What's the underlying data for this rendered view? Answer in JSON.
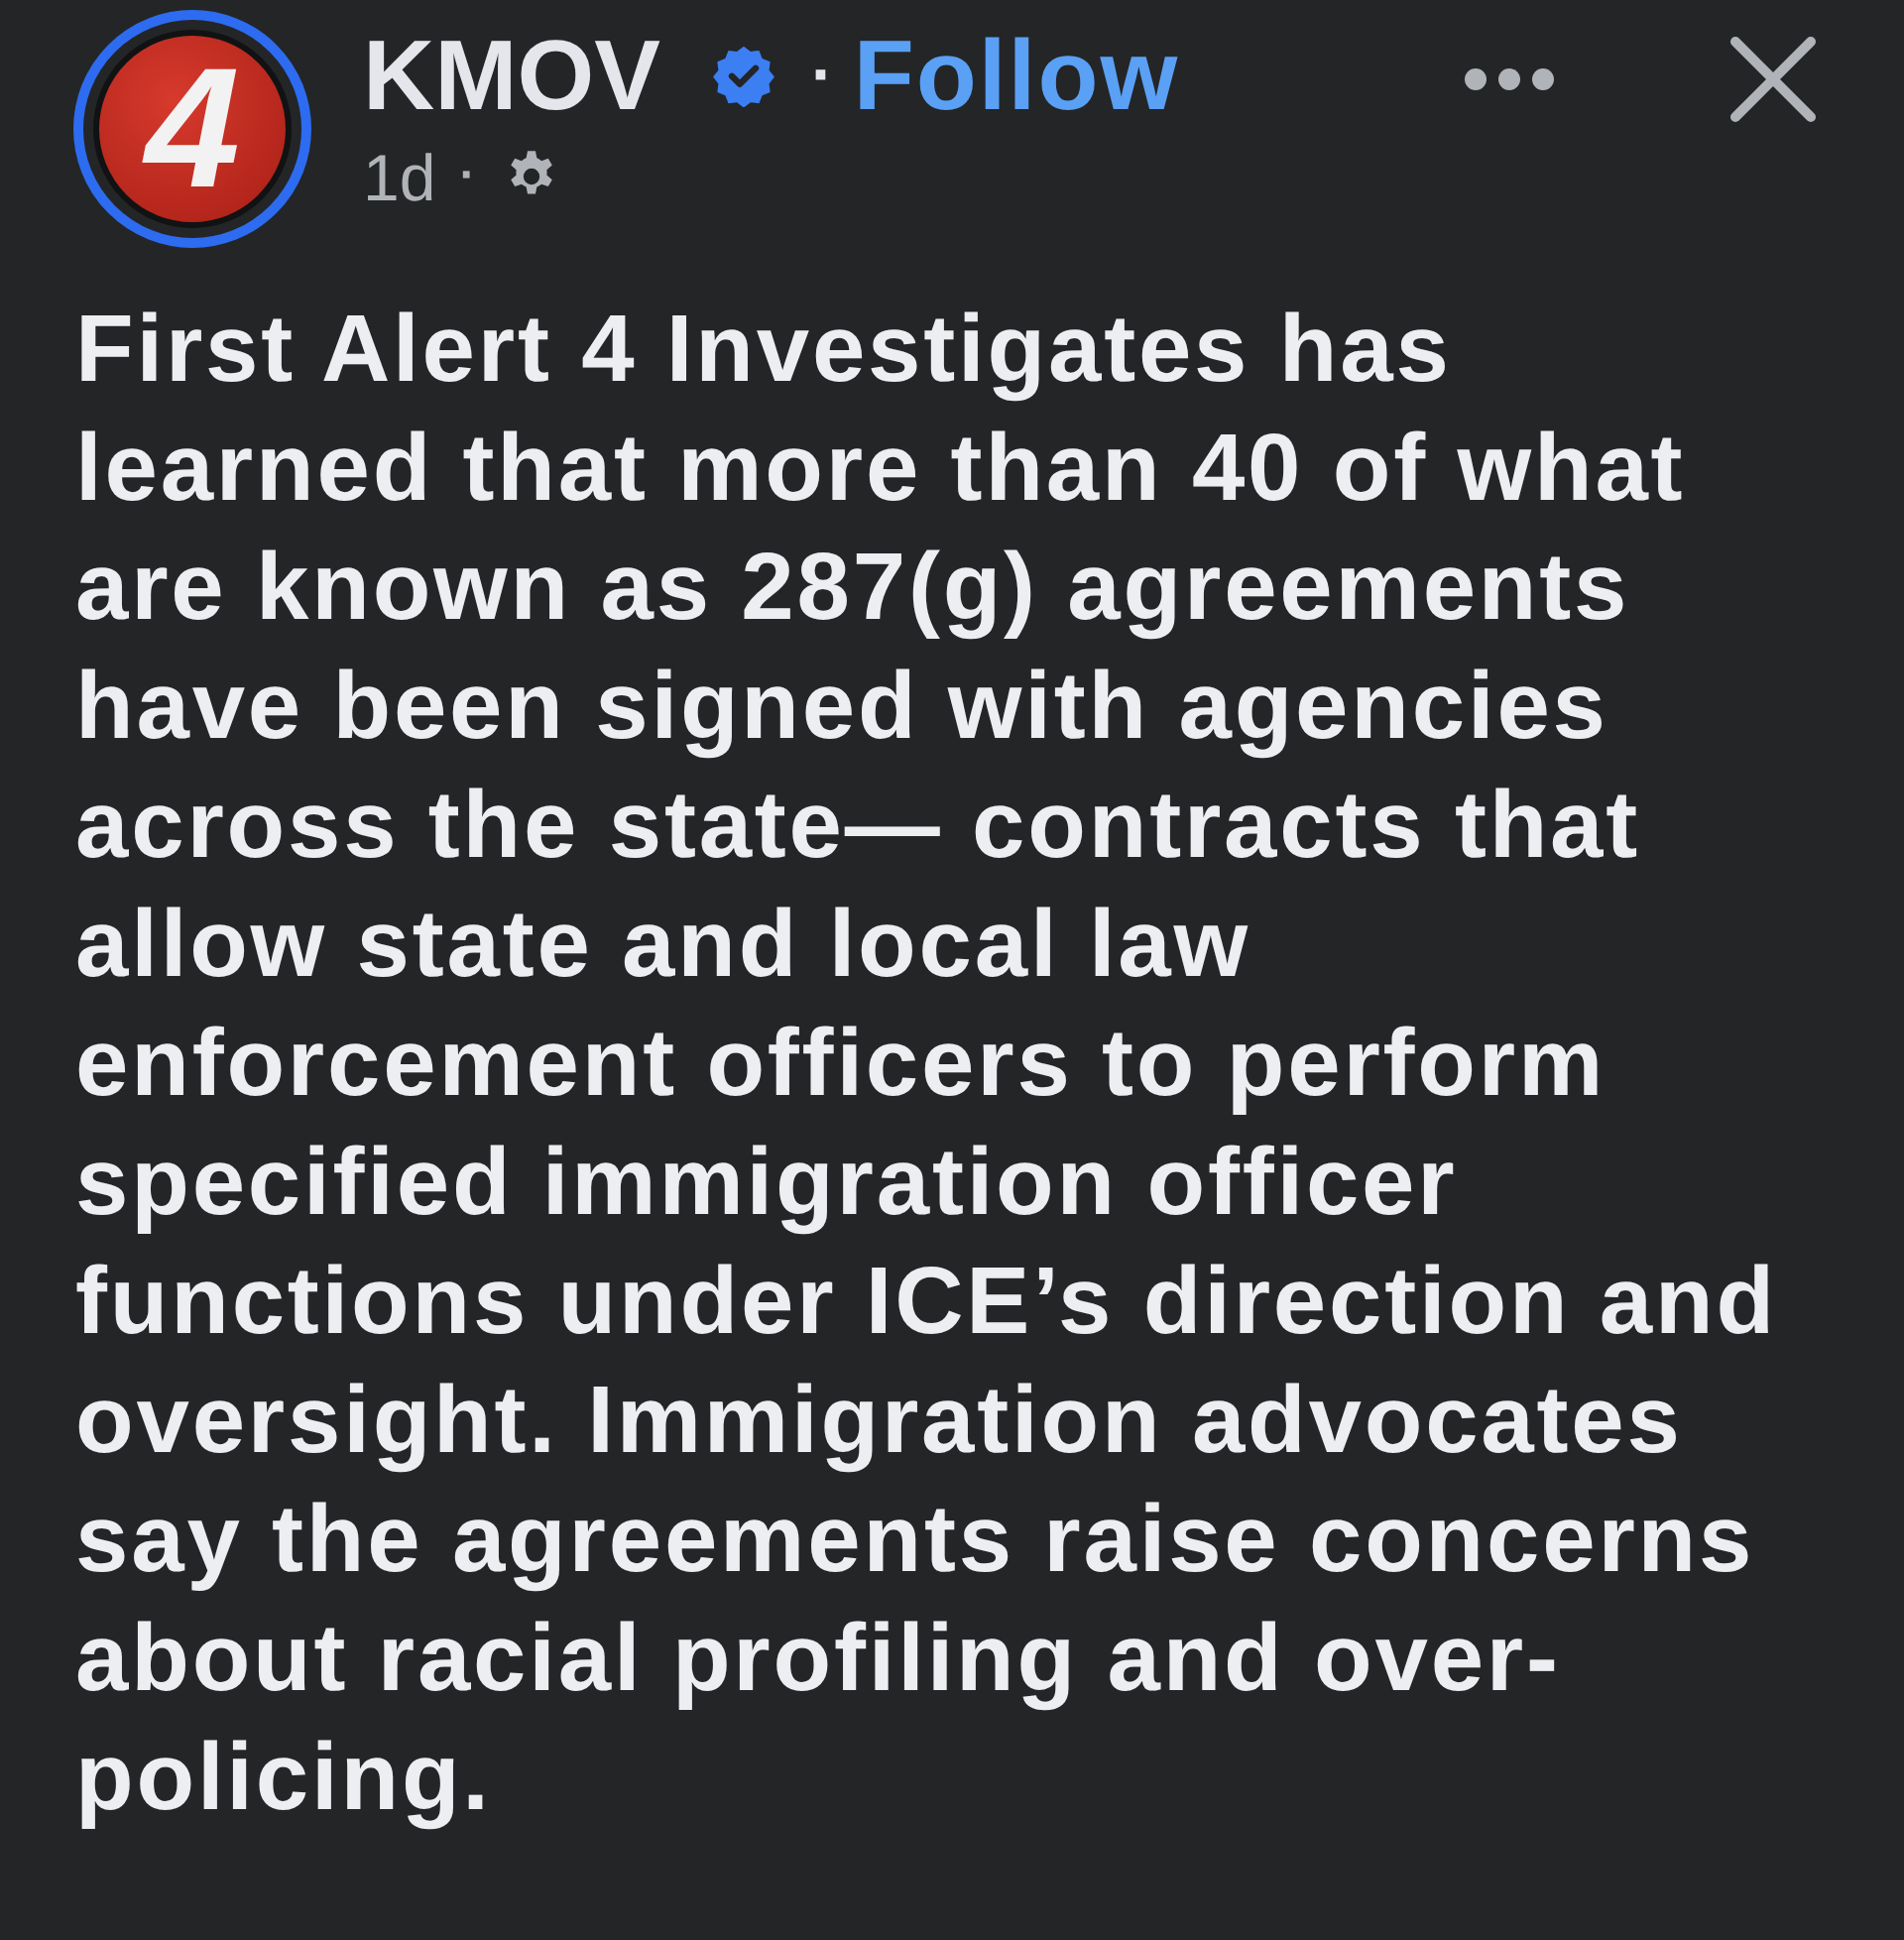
{
  "post": {
    "avatar": {
      "logo_text": "4",
      "story_ring": true
    },
    "author": "KMOV",
    "verified": true,
    "separator": "·",
    "follow": "Follow",
    "time": "1d",
    "time_separator": "·",
    "body": "First Alert 4 Investigates has learned that more than 40 of what are known as 287(g) agreements have been signed with agencies across the state— contracts that allow state and local law enforcement officers to perform specified immigration officer functions under ICE’s direction and oversight. Immigration advocates say the agreements raise concerns about racial profiling and over-policing."
  }
}
